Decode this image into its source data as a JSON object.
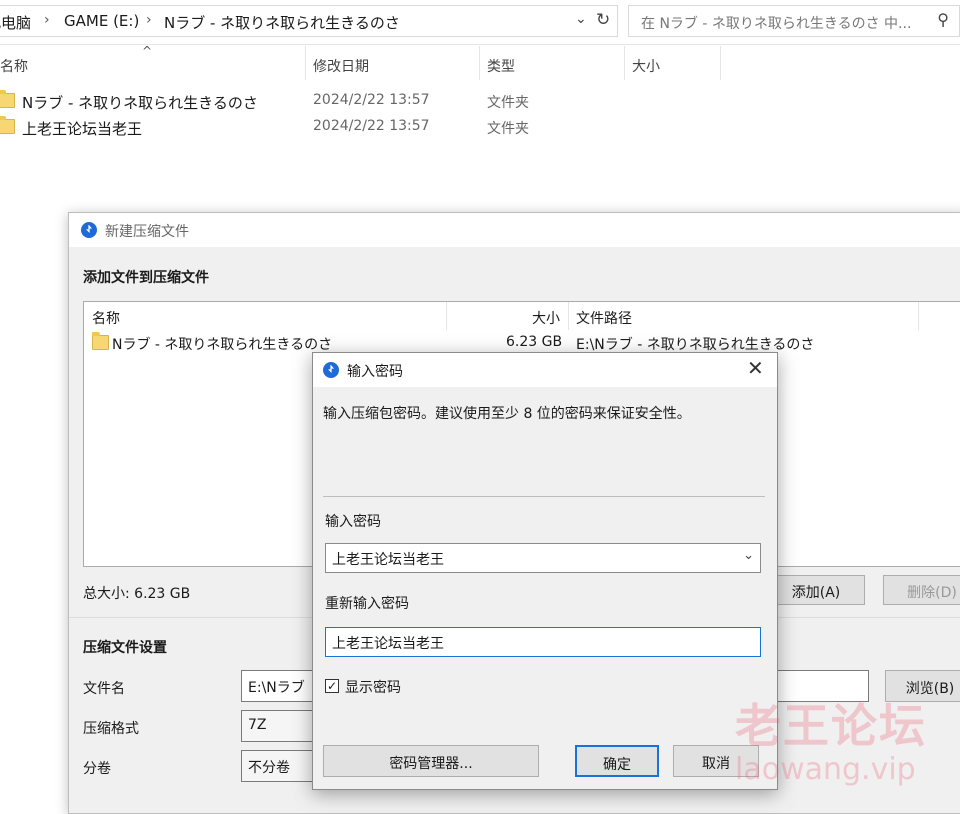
{
  "explorer": {
    "breadcrumbs": [
      "此电脑",
      "GAME (E:)",
      "Nラブ - ネ取りネ取られ生きるのさ"
    ],
    "search_placeholder": "在 Nラブ - ネ取りネ取られ生きるのさ 中...",
    "columns": [
      "名称",
      "修改日期",
      "类型",
      "大小"
    ],
    "rows": [
      {
        "name": "Nラブ - ネ取りネ取られ生きるのさ",
        "date": "2024/2/22 13:57",
        "type": "文件夹"
      },
      {
        "name": "上老王论坛当老王",
        "date": "2024/2/22 13:57",
        "type": "文件夹"
      }
    ]
  },
  "archive": {
    "title": "新建压缩文件",
    "section_add": "添加文件到压缩文件",
    "list_columns": [
      "名称",
      "大小",
      "文件路径"
    ],
    "list_rows": [
      {
        "name": "Nラブ - ネ取りネ取られ生きるのさ",
        "size": "6.23 GB",
        "path": "E:\\Nラブ - ネ取りネ取られ生きるのさ"
      }
    ],
    "total_size": "总大小: 6.23 GB",
    "add_button": "添加(A)",
    "delete_button": "删除(D)",
    "section_settings": "压缩文件设置",
    "filename_label": "文件名",
    "filename_value": "E:\\Nラブ",
    "browse_button": "浏览(B)",
    "format_label": "压缩格式",
    "format_value": "7Z",
    "split_label": "分卷",
    "split_value": "不分卷"
  },
  "password_dialog": {
    "title": "输入密码",
    "description": "输入压缩包密码。建议使用至少 8 位的密码来保证安全性。",
    "password_label": "输入密码",
    "password_value": "上老王论坛当老王",
    "reenter_label": "重新输入密码",
    "reenter_value": "上老王论坛当老王",
    "show_password_label": "显示密码",
    "show_password_checked": true,
    "manager_button": "密码管理器...",
    "ok_button": "确定",
    "cancel_button": "取消"
  },
  "watermark": {
    "text": "老王论坛",
    "url": "laowang.vip"
  }
}
